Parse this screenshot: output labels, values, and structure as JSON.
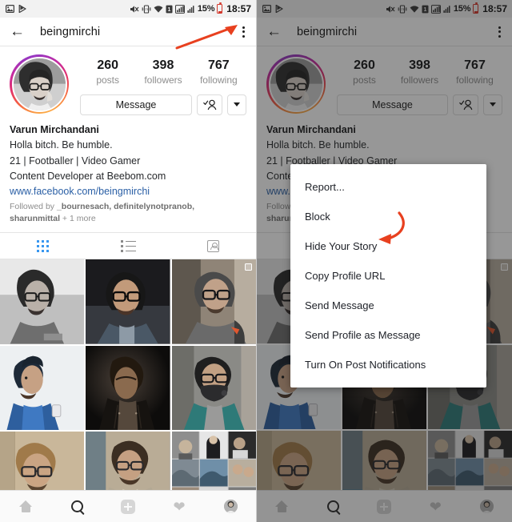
{
  "status_bar": {
    "left_icons": [
      "image-icon",
      "play-store-icon"
    ],
    "right_icons": [
      "mute-icon",
      "vibrate-icon",
      "wifi-icon",
      "sim-icon",
      "signal-icon",
      "signal2-icon"
    ],
    "battery_percent": "15%",
    "time": "18:57"
  },
  "app_bar": {
    "back_icon": "back-arrow-icon",
    "title": "beingmirchi",
    "menu_icon": "kebab-menu-icon"
  },
  "profile": {
    "avatar_alt": "profile-avatar",
    "stats": [
      {
        "num": "260",
        "label": "posts"
      },
      {
        "num": "398",
        "label": "followers"
      },
      {
        "num": "767",
        "label": "following"
      }
    ],
    "message_button": "Message",
    "follow_icon": "person-check-icon",
    "dropdown_icon": "caret-down-icon"
  },
  "bio": {
    "name": "Varun Mirchandani",
    "line1": "Holla bitch. Be humble.",
    "line2": "21 | Footballer | Video Gamer",
    "line3": "Content Developer at Beebom.com",
    "link": "www.facebook.com/beingmirchi",
    "followed_by_prefix": "Followed by ",
    "followed_by_names": "_bournesach, definitelynotpranob, sharunmittal",
    "followed_by_suffix": " + 1 more"
  },
  "tabs": [
    {
      "name": "grid-tab",
      "icon": "grid-icon",
      "active": true
    },
    {
      "name": "list-tab",
      "icon": "list-icon",
      "active": false
    },
    {
      "name": "tagged-tab",
      "icon": "tagged-person-icon",
      "active": false
    }
  ],
  "grid": {
    "posts": [
      {
        "id": "post-1",
        "desc": "black-and-white portrait man with glasses",
        "multi": false
      },
      {
        "id": "post-2",
        "desc": "man with glasses dark background",
        "multi": false
      },
      {
        "id": "post-3",
        "desc": "man in street with backpack",
        "multi": true
      },
      {
        "id": "post-4",
        "desc": "man in blue tshirt looking at phone",
        "multi": false
      },
      {
        "id": "post-5",
        "desc": "man in leather jacket dark moody",
        "multi": false
      },
      {
        "id": "post-6",
        "desc": "man wearing black face mask teal hoodie",
        "multi": false
      },
      {
        "id": "post-7",
        "desc": "man with glasses smiling beige wall",
        "multi": false
      },
      {
        "id": "post-8",
        "desc": "man in grey hoodie sitting",
        "multi": false
      },
      {
        "id": "post-9",
        "desc": "photo collage grid",
        "multi": false
      }
    ]
  },
  "bottom_nav": [
    {
      "name": "home-tab",
      "icon": "home-icon",
      "active": false
    },
    {
      "name": "search-tab",
      "icon": "search-icon",
      "active": true
    },
    {
      "name": "add-post-tab",
      "icon": "plus-square-icon",
      "active": false
    },
    {
      "name": "activity-tab",
      "icon": "heart-icon",
      "active": false
    },
    {
      "name": "profile-tab",
      "icon": "avatar-icon",
      "active": false
    }
  ],
  "menu": {
    "items": [
      "Report...",
      "Block",
      "Hide Your Story",
      "Copy Profile URL",
      "Send Message",
      "Send Profile as Message",
      "Turn On Post Notifications"
    ]
  },
  "annotations": {
    "color": "#e8401f",
    "left_arrow_target": "kebab-menu-icon",
    "right_arrow_target": "Hide Your Story"
  }
}
